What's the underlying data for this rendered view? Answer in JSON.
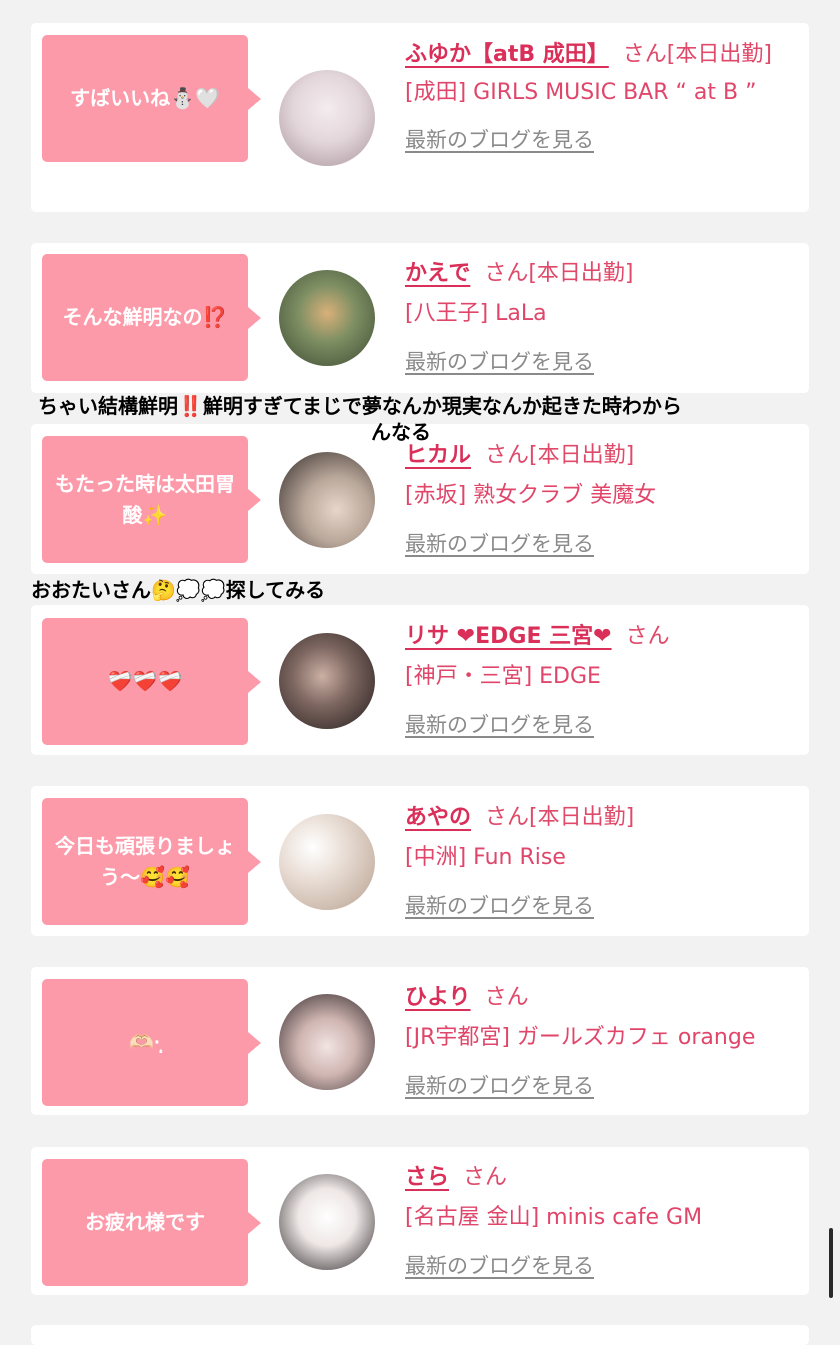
{
  "cards": [
    {
      "message": "すばいいね⛄🤍",
      "name": "ふゆか【atB 成田】",
      "suffix": "さん[本日出勤]",
      "shop": "[成田] GIRLS MUSIC BAR “ at B ”",
      "blog_link": "最新のブログを見る",
      "avatar_colors": [
        "#efe6ea",
        "#c9b7bd"
      ]
    },
    {
      "message": "そんな鮮明なの⁉️",
      "name": "かえで",
      "suffix": "さん[本日出勤]",
      "shop": "[八王子] LaLa",
      "blog_link": "最新のブログを見る",
      "avatar_colors": [
        "#6f8f6a",
        "#3c4a35"
      ]
    },
    {
      "message": "もたった時は太田胃酸✨",
      "name": "ヒカル",
      "suffix": "さん[本日出勤]",
      "shop": "[赤坂] 熟女クラブ 美魔女",
      "blog_link": "最新のブログを見る",
      "avatar_colors": [
        "#e9e2dc",
        "#3a3330"
      ]
    },
    {
      "message": "❤️‍🩹❤️‍🩹❤️‍🩹",
      "name": "リサ ❤EDGE 三宮❤",
      "suffix": "さん",
      "shop": "[神戸・三宮] EDGE",
      "blog_link": "最新のブログを見る",
      "avatar_colors": [
        "#b9a39b",
        "#2b2322"
      ]
    },
    {
      "message": "今日も頑張りましょう〜🥰🥰",
      "name": "あやの",
      "suffix": "さん[本日出勤]",
      "shop": "[中洲] Fun Rise",
      "blog_link": "最新のブログを見る",
      "avatar_colors": [
        "#f3ece6",
        "#cdb9a6"
      ]
    },
    {
      "message": "🫶🏻·̩͙",
      "name": "ひより",
      "suffix": "さん",
      "shop": "[JR宇都宮] ガールズカフェ orange",
      "blog_link": "最新のブログを見る",
      "avatar_colors": [
        "#f1e9ea",
        "#2d2428"
      ]
    },
    {
      "message": "お疲れ様です",
      "name": "さら",
      "suffix": "さん",
      "shop": "[名古屋 金山] minis cafe GM",
      "blog_link": "最新のブログを見る",
      "avatar_colors": [
        "#f5f1ef",
        "#1f1b1d"
      ]
    }
  ],
  "overlays": {
    "overlay_1_line1": "ちゃい結構鮮明‼️鮮明すぎてまじで夢なんか現実なんか起きた時わから",
    "overlay_1_line2": "んなる",
    "overlay_2": "おおたいさん🤔💭💭探してみる"
  }
}
